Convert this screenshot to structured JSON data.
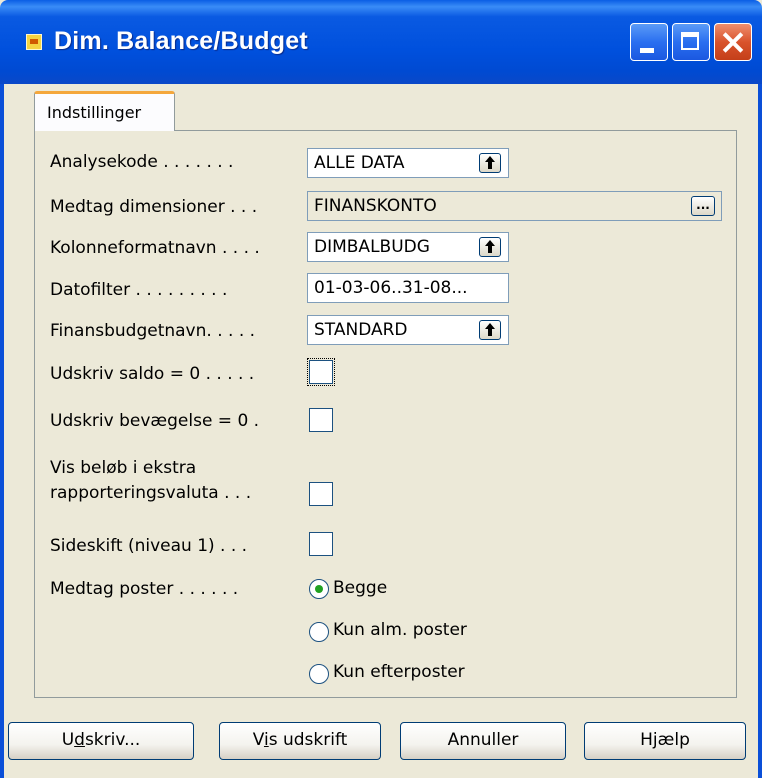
{
  "window": {
    "title": "Dim. Balance/Budget"
  },
  "tabs": [
    {
      "label": "Indstillinger",
      "active": true
    }
  ],
  "form": {
    "analysekode": {
      "label": "Analysekode",
      "dots": " . . . . . . .",
      "value": "ALLE DATA"
    },
    "medtag_dimensioner": {
      "label": "Medtag dimensioner",
      "dots": " . . .",
      "value": "FINANSKONTO",
      "button_label": "..."
    },
    "kolonneformatnavn": {
      "label": "Kolonneformatnavn",
      "dots": " . . . .",
      "value": "DIMBALBUDG"
    },
    "datofilter": {
      "label": "Datofilter",
      "dots": " . . . . . . . . .",
      "value": "01-03-06..31-08..."
    },
    "finansbudgetnavn": {
      "label": "Finansbudgetnavn.",
      "dots": " . . . .",
      "value": "STANDARD"
    },
    "udskriv_saldo": {
      "label": "Udskriv saldo = 0",
      "dots": " . . . . .",
      "checked": false
    },
    "udskriv_bevaegelse": {
      "label": "Udskriv bevægelse = 0",
      "dots": " .",
      "checked": false
    },
    "vis_beloeb": {
      "label_line1": "Vis beløb i ekstra",
      "label_line2": "rapporteringsvaluta",
      "dots": " . . .",
      "checked": false
    },
    "sideskift": {
      "label": "Sideskift (niveau 1)",
      "dots": " . . .",
      "checked": false
    },
    "medtag_poster": {
      "label": "Medtag poster",
      "dots": " . . . . . .",
      "options": [
        "Begge",
        "Kun alm. poster",
        "Kun efterposter"
      ],
      "selected": "Begge"
    }
  },
  "buttons": {
    "udskriv": {
      "pre": "U",
      "underlined": "d",
      "post": "skriv..."
    },
    "vis_udskrift": {
      "pre": "V",
      "underlined": "i",
      "post": "s udskrift"
    },
    "annuller": {
      "label": "Annuller"
    },
    "hjaelp": {
      "label": "Hjælp"
    }
  },
  "colors": {
    "titlebar": "#0050dd",
    "accent_tab": "#f4a73c",
    "dialog_bg": "#ece9d8"
  }
}
